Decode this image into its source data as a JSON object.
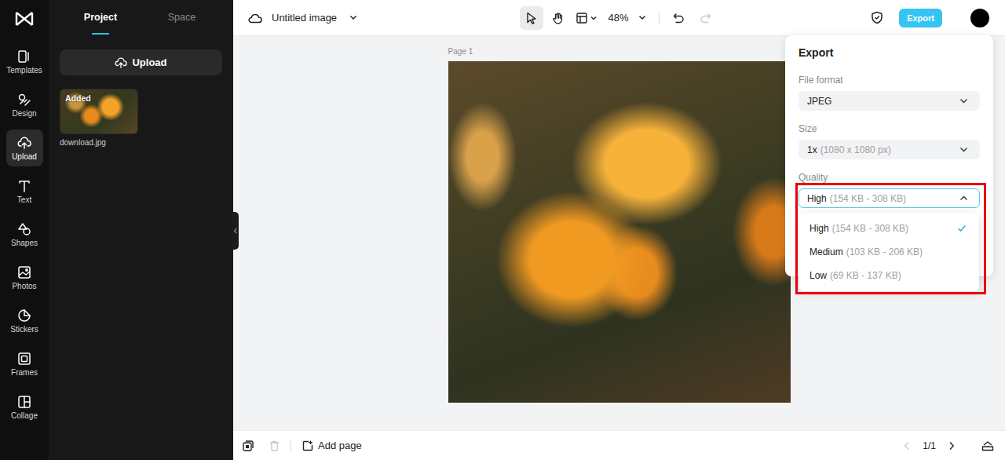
{
  "rail": [
    {
      "label": "Templates",
      "kind": "templates",
      "selected": false
    },
    {
      "label": "Design",
      "kind": "design",
      "selected": false
    },
    {
      "label": "Upload",
      "kind": "upload",
      "selected": true
    },
    {
      "label": "Text",
      "kind": "text",
      "selected": false
    },
    {
      "label": "Shapes",
      "kind": "shapes",
      "selected": false
    },
    {
      "label": "Photos",
      "kind": "photos",
      "selected": false
    },
    {
      "label": "Stickers",
      "kind": "stickers",
      "selected": false
    },
    {
      "label": "Frames",
      "kind": "frames",
      "selected": false
    },
    {
      "label": "Collage",
      "kind": "collage",
      "selected": false
    }
  ],
  "panel": {
    "tabs": [
      {
        "label": "Project",
        "selected": true
      },
      {
        "label": "Space",
        "selected": false
      }
    ],
    "upload_button": "Upload",
    "assets": [
      {
        "name": "download.jpg",
        "badge": "Added"
      }
    ]
  },
  "toolbar": {
    "title": "Untitled image",
    "tools": [
      {
        "kind": "select",
        "selected": true
      },
      {
        "kind": "hand",
        "selected": false
      }
    ],
    "zoom": "48%",
    "undo_disabled": false,
    "redo_disabled": true,
    "export_button": "Export"
  },
  "canvas": {
    "page_label": "Page 1"
  },
  "bottom_bar": {
    "add_page": "Add page",
    "page_count": "1/1",
    "delete_disabled": true,
    "prev_disabled": true,
    "next_disabled": false
  },
  "export": {
    "title": "Export",
    "fields": [
      {
        "label": "File format",
        "value": "JPEG",
        "detail": "",
        "open": false,
        "highlighted": false
      },
      {
        "label": "Size",
        "value": "1x",
        "detail": "(1080 x 1080 px)",
        "open": false,
        "highlighted": false
      },
      {
        "label": "Quality",
        "value": "High",
        "detail": "(154 KB - 308 KB)",
        "open": true,
        "highlighted": true
      }
    ],
    "quality_options": [
      {
        "label": "High",
        "detail": "(154 KB - 308 KB)",
        "selected": true
      },
      {
        "label": "Medium",
        "detail": "(103 KB - 206 KB)",
        "selected": false
      },
      {
        "label": "Low",
        "detail": "(69 KB - 137 KB)",
        "selected": false
      }
    ]
  }
}
